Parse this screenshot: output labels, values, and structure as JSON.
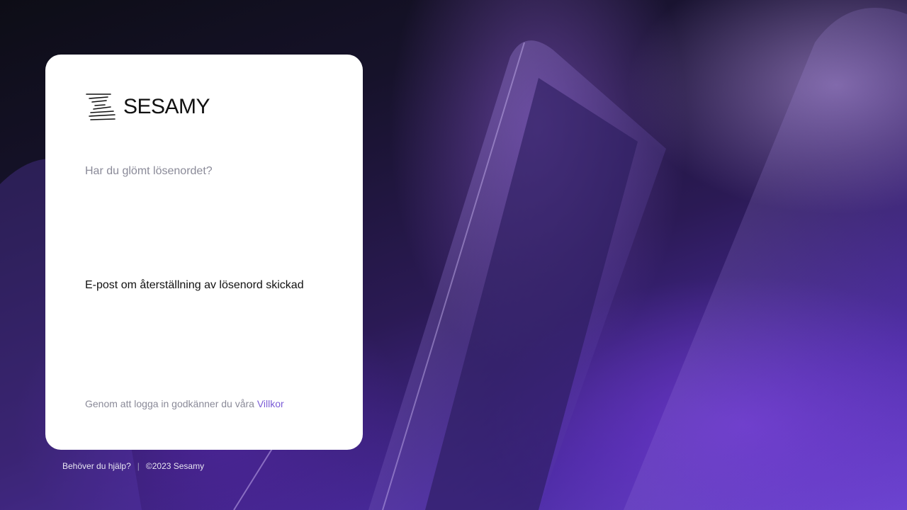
{
  "colors": {
    "accent": "#7b5cd6",
    "card_background": "#ffffff",
    "muted_text": "#8a8a98"
  },
  "logo": {
    "icon": "sesamy-stripes-icon",
    "text": "SESAMY"
  },
  "card": {
    "subtitle": "Har du glömt lösenordet?",
    "message": "E-post om återställning av lösenord skickad",
    "terms_prefix": "Genom att logga in godkänner du våra",
    "terms_link": "Villkor"
  },
  "footer": {
    "help_link": "Behöver du hjälp?",
    "separator": "|",
    "copyright": "©2023 Sesamy"
  }
}
